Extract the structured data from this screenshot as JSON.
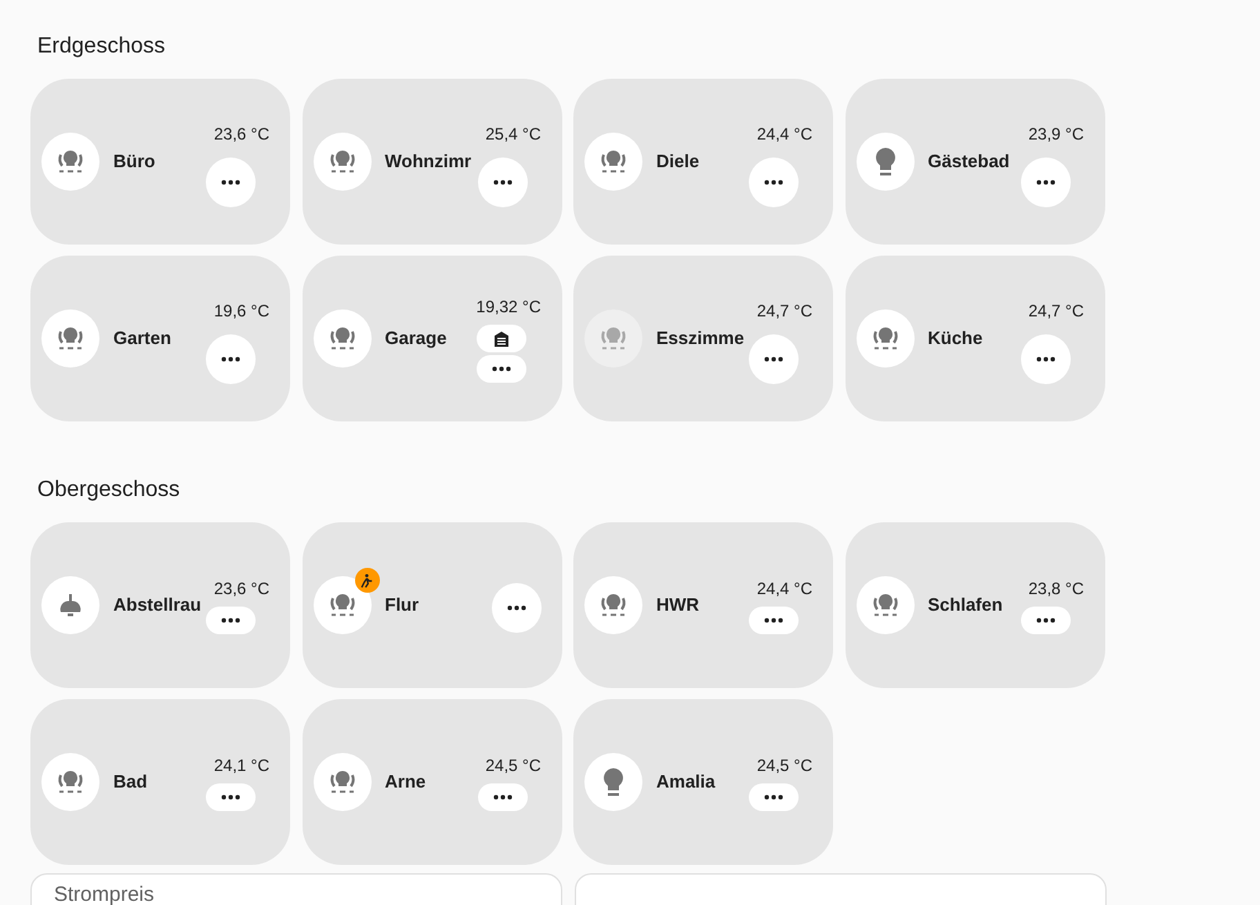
{
  "sections": [
    {
      "title": "Erdgeschoss",
      "rooms": [
        {
          "name": "Büro",
          "temperature": "23,6 °C",
          "kind": "light_group",
          "active": true,
          "compact": false,
          "buttons": [
            {
              "kind": "more"
            }
          ]
        },
        {
          "name": "Wohnzimr",
          "temperature": "25,4 °C",
          "kind": "light_group",
          "active": true,
          "compact": false,
          "buttons": [
            {
              "kind": "more"
            }
          ]
        },
        {
          "name": "Diele",
          "temperature": "24,4 °C",
          "kind": "light_group",
          "active": true,
          "compact": false,
          "buttons": [
            {
              "kind": "more"
            }
          ]
        },
        {
          "name": "Gästebad",
          "temperature": "23,9 °C",
          "kind": "light",
          "active": true,
          "compact": false,
          "buttons": [
            {
              "kind": "more"
            }
          ]
        },
        {
          "name": "Garten",
          "temperature": "19,6 °C",
          "kind": "light_group",
          "active": true,
          "compact": false,
          "buttons": [
            {
              "kind": "more"
            }
          ]
        },
        {
          "name": "Garage",
          "temperature": "19,32 °C",
          "kind": "light_group",
          "active": true,
          "compact": true,
          "buttons": [
            {
              "kind": "garage"
            },
            {
              "kind": "more"
            }
          ]
        },
        {
          "name": "Esszimme",
          "temperature": "24,7 °C",
          "kind": "light_group",
          "active": false,
          "compact": false,
          "buttons": [
            {
              "kind": "more"
            }
          ]
        },
        {
          "name": "Küche",
          "temperature": "24,7 °C",
          "kind": "light_group",
          "active": true,
          "compact": false,
          "buttons": [
            {
              "kind": "more"
            }
          ]
        }
      ]
    },
    {
      "title": "Obergeschoss",
      "rooms": [
        {
          "name": "Abstellrau",
          "temperature": "23,6 °C",
          "kind": "ceiling_lamp",
          "active": true,
          "compact": true,
          "buttons": [
            {
              "kind": "more"
            }
          ]
        },
        {
          "name": "Flur",
          "kind": "light_group",
          "active": true,
          "compact": false,
          "motion": true,
          "buttons": [
            {
              "kind": "more"
            }
          ]
        },
        {
          "name": "HWR",
          "temperature": "24,4 °C",
          "kind": "light_group",
          "active": true,
          "compact": true,
          "buttons": [
            {
              "kind": "more"
            }
          ]
        },
        {
          "name": "Schlafen",
          "temperature": "23,8 °C",
          "kind": "light_group",
          "active": true,
          "compact": true,
          "buttons": [
            {
              "kind": "more"
            }
          ]
        },
        {
          "name": "Bad",
          "temperature": "24,1 °C",
          "kind": "light_group",
          "active": true,
          "compact": true,
          "buttons": [
            {
              "kind": "more"
            }
          ]
        },
        {
          "name": "Arne",
          "temperature": "24,5 °C",
          "kind": "light_group",
          "active": true,
          "compact": true,
          "buttons": [
            {
              "kind": "more"
            }
          ]
        },
        {
          "name": "Amalia",
          "temperature": "24,5 °C",
          "kind": "light",
          "active": true,
          "compact": true,
          "buttons": [
            {
              "kind": "more"
            }
          ]
        }
      ]
    }
  ],
  "price_card": {
    "title": "Strompreis"
  }
}
